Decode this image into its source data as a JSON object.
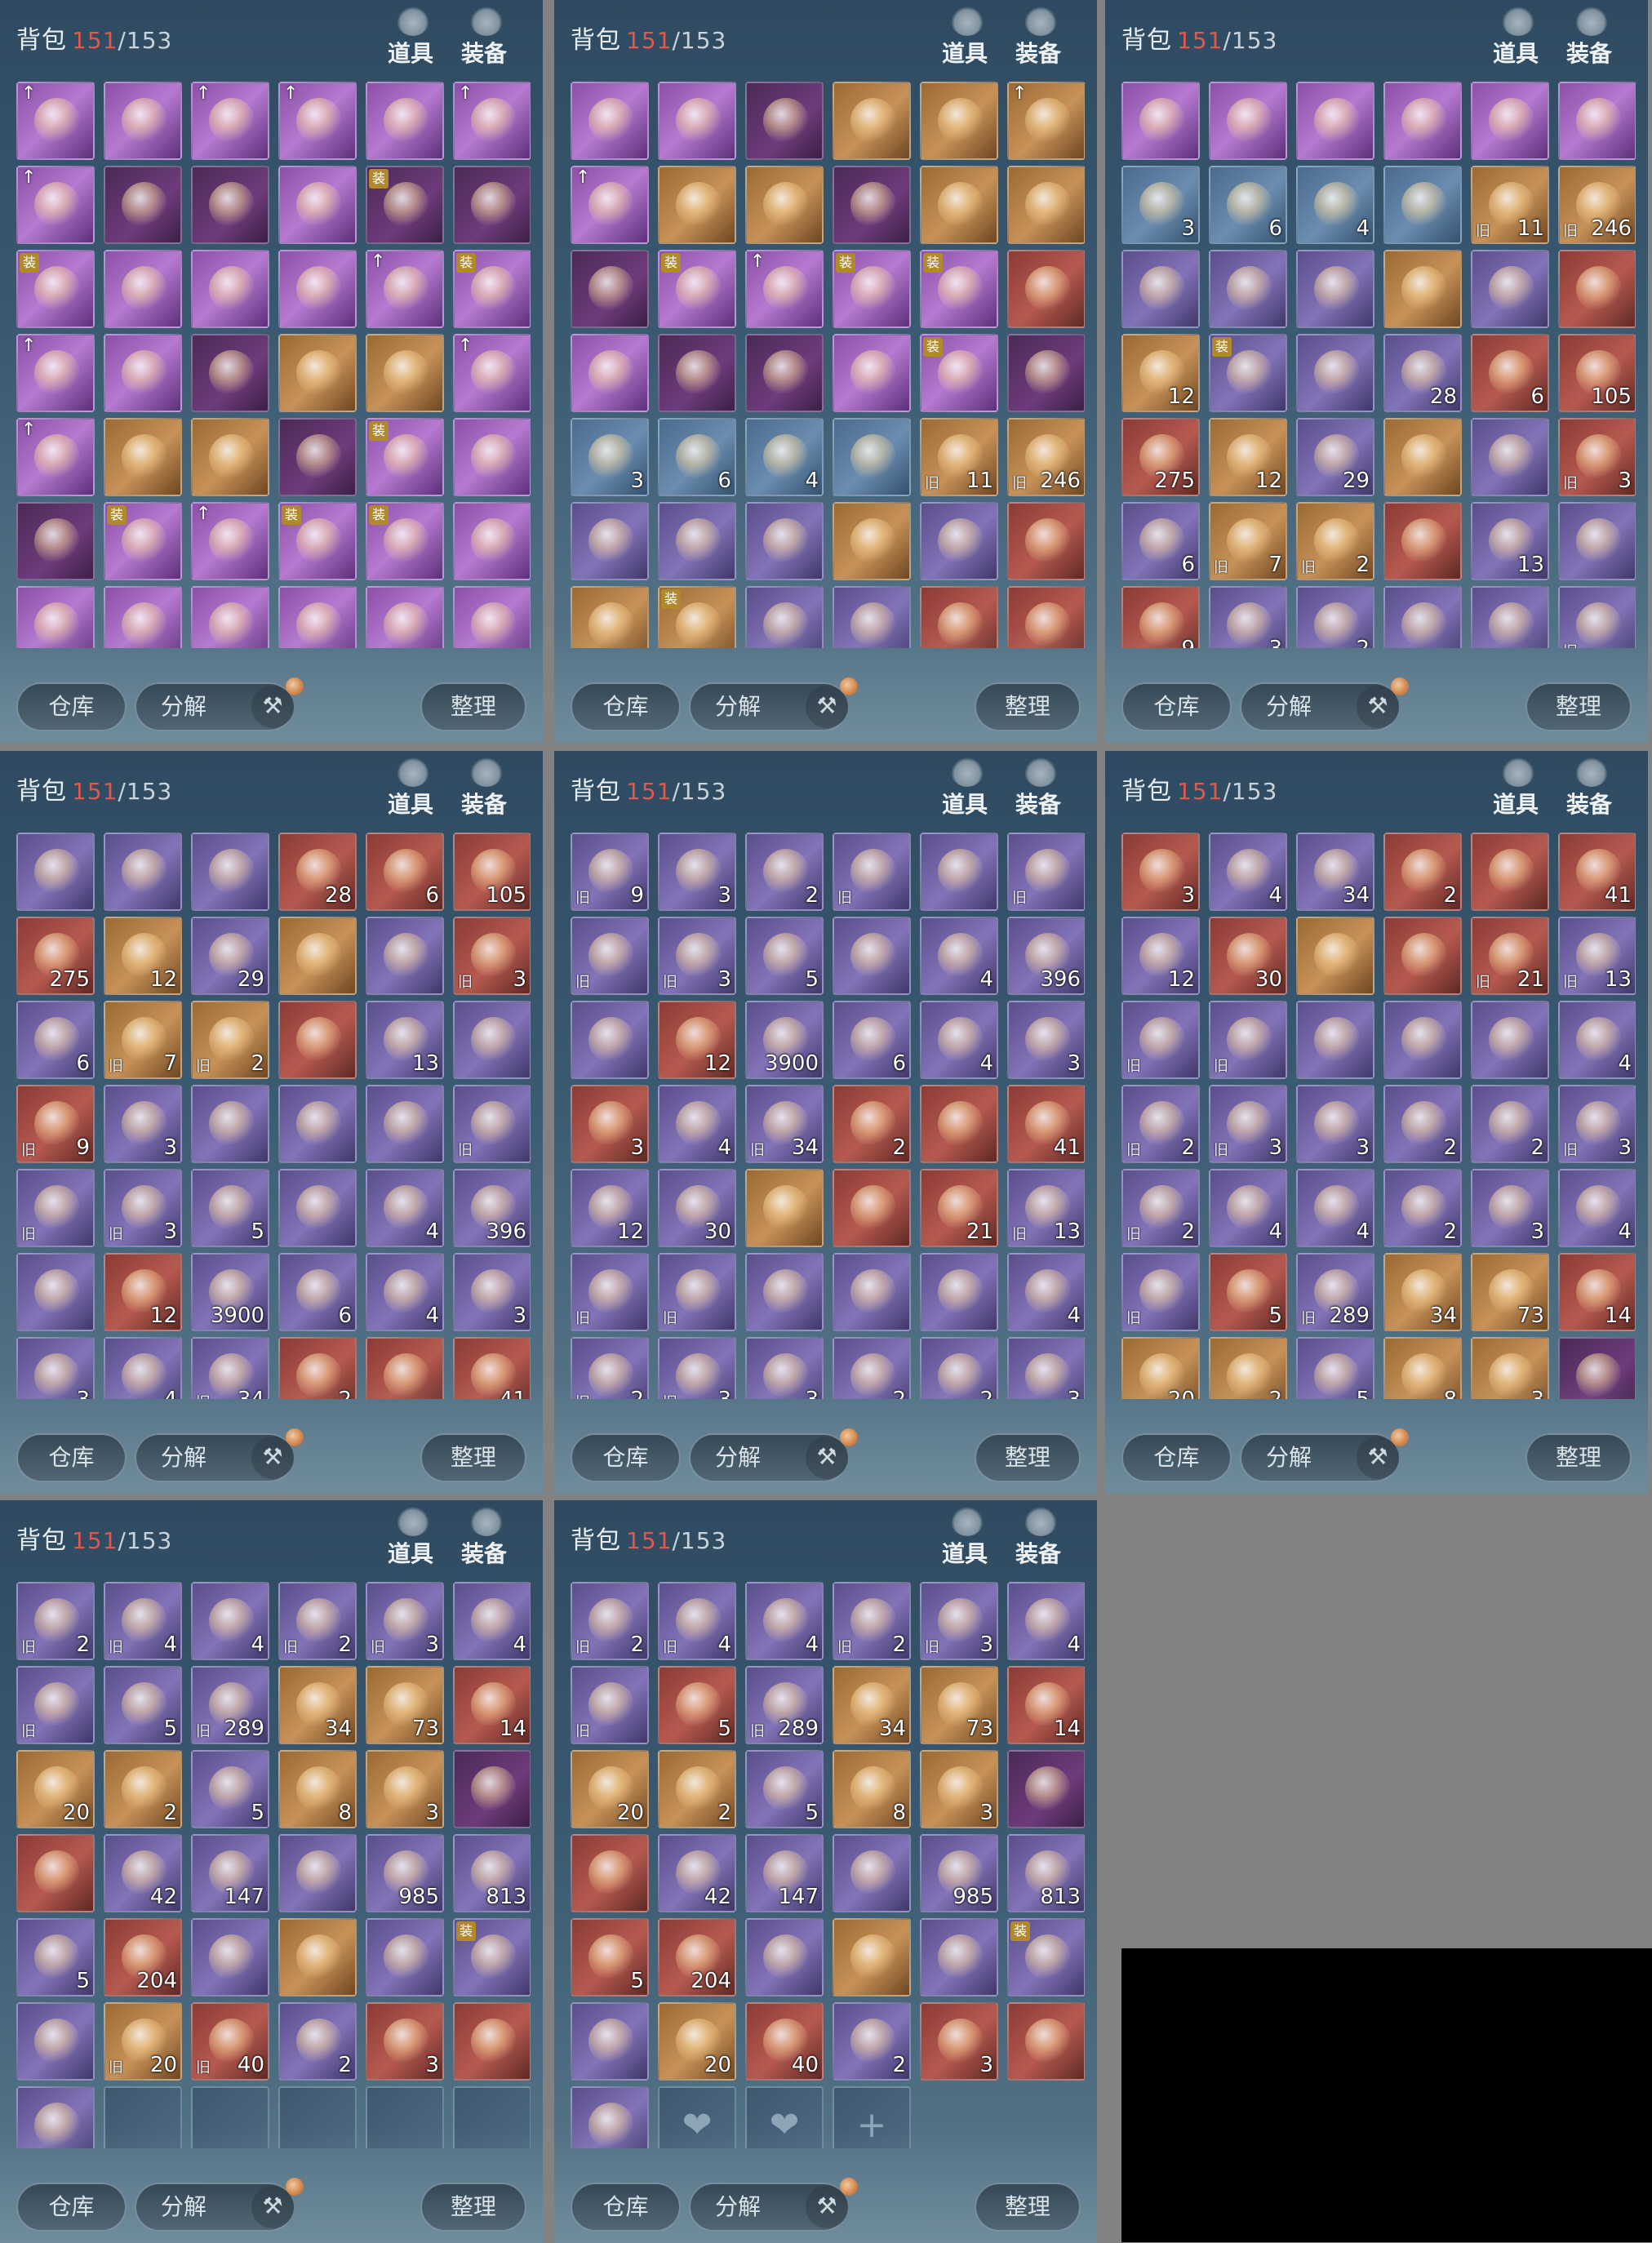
{
  "header": {
    "title": "背包",
    "count_current": "151",
    "count_sep": "/",
    "count_max": "153",
    "tab_items": "道具",
    "tab_equip": "装备"
  },
  "footer": {
    "warehouse": "仓库",
    "decompose": "分解",
    "sort": "整理"
  },
  "labels": {
    "old": "旧",
    "equip_badge": "装",
    "plus": "+"
  },
  "colors": {
    "count_current": "#e2574c",
    "background": "#828282"
  },
  "panels": [
    {
      "name": "p1",
      "rows": [
        [
          "purple::up",
          "purple::",
          "purple::up",
          "purple::up",
          "purple::",
          "purple::up"
        ],
        [
          "purple::up",
          "dpurple::",
          "dpurple::",
          "purple::",
          "dpurple::eq",
          "dpurple::"
        ],
        [
          "purple::eq",
          "purple::",
          "purple::",
          "purple::",
          "purple::up",
          "purple::eq"
        ],
        [
          "purple::up",
          "purple::",
          "dpurple::",
          "gold::",
          "gold::",
          "purple::up"
        ],
        [
          "purple::up",
          "gold::",
          "gold::",
          "dpurple::",
          "purple::eq",
          "purple::"
        ],
        [
          "dpurple::",
          "purple::eq",
          "purple::up",
          "purple::eq",
          "purple::eq",
          "purple::"
        ],
        [
          "purple::",
          "purple::",
          "purple::",
          "purple::",
          "purple::",
          "purple::"
        ]
      ]
    },
    {
      "name": "p2",
      "rows": [
        [
          "purple::",
          "purple::",
          "dpurple::",
          "gold::",
          "gold::",
          "gold::up"
        ],
        [
          "purple::up",
          "gold::",
          "gold::",
          "dpurple::",
          "gold::",
          "gold::"
        ],
        [
          "dpurple::",
          "purple::eq",
          "purple::up",
          "purple::eq",
          "purple::eq",
          "red::"
        ],
        [
          "purple::",
          "dpurple::",
          "dpurple::",
          "purple::",
          "purple::eq",
          "dpurple::"
        ],
        [
          "blue:3:",
          "blue:6:",
          "blue:4:",
          "blue::",
          "gold:11:old",
          "gold:246:old"
        ],
        [
          "violet::",
          "violet::",
          "violet::",
          "gold::",
          "violet::",
          "red::"
        ],
        [
          "gold::",
          "gold::eq",
          "violet::",
          "violet::",
          "red::",
          "red::"
        ]
      ]
    },
    {
      "name": "p3",
      "rows": [
        [
          "purple::",
          "purple::",
          "purple::",
          "purple::",
          "purple::",
          "purple::"
        ],
        [
          "blue:3:",
          "blue:6:",
          "blue:4:",
          "blue::",
          "gold:11:old",
          "gold:246:old"
        ],
        [
          "violet::",
          "violet::",
          "violet::",
          "gold::",
          "violet::",
          "red::"
        ],
        [
          "gold:12:",
          "violet::eq",
          "violet::",
          "violet:28:",
          "red:6:",
          "red:105:"
        ],
        [
          "red:275:",
          "gold:12:",
          "violet:29:",
          "gold::",
          "violet::",
          "red:3:old"
        ],
        [
          "violet:6:",
          "gold:7:old",
          "gold:2:old",
          "red::",
          "violet:13:",
          "violet::"
        ],
        [
          "red:9:",
          "violet:3:",
          "violet:2:",
          "violet::",
          "violet::",
          "violet::old"
        ]
      ]
    },
    {
      "name": "p4",
      "rows": [
        [
          "violet::",
          "violet::",
          "violet::",
          "red:28:",
          "red:6:",
          "red:105:"
        ],
        [
          "red:275:",
          "gold:12:",
          "violet:29:",
          "gold::",
          "violet::",
          "red:3:old"
        ],
        [
          "violet:6:",
          "gold:7:old",
          "gold:2:old",
          "red::",
          "violet:13:",
          "violet::"
        ],
        [
          "red:9:old",
          "violet:3:",
          "violet::",
          "violet::",
          "violet::",
          "violet::old"
        ],
        [
          "violet::old",
          "violet:3:old",
          "violet:5:",
          "violet::",
          "violet:4:",
          "violet:396:"
        ],
        [
          "violet::",
          "red:12:",
          "violet:3900:",
          "violet:6:",
          "violet:4:",
          "violet:3:"
        ],
        [
          "violet:3:",
          "violet:4:",
          "violet:34:old",
          "red:2:",
          "red::",
          "red:41:"
        ]
      ]
    },
    {
      "name": "p5",
      "rows": [
        [
          "violet:9:old",
          "violet:3:",
          "violet:2:",
          "violet::old",
          "violet::",
          "violet::old"
        ],
        [
          "violet::old",
          "violet:3:old",
          "violet:5:",
          "violet::",
          "violet:4:",
          "violet:396:"
        ],
        [
          "violet::",
          "red:12:",
          "violet:3900:",
          "violet:6:",
          "violet:4:",
          "violet:3:"
        ],
        [
          "red:3:",
          "violet:4:",
          "violet:34:old",
          "red:2:",
          "red::",
          "red:41:"
        ],
        [
          "violet:12:",
          "violet:30:",
          "gold::",
          "red::",
          "red:21:",
          "violet:13:old"
        ],
        [
          "violet::old",
          "violet::old",
          "violet::",
          "violet::",
          "violet::",
          "violet:4:"
        ],
        [
          "violet:2:old",
          "violet:3:old",
          "violet:3:",
          "violet:2:",
          "violet:2:",
          "violet:3:"
        ]
      ]
    },
    {
      "name": "p6",
      "rows": [
        [
          "red:3:",
          "violet:4:",
          "violet:34:",
          "red:2:",
          "red::",
          "red:41:"
        ],
        [
          "violet:12:",
          "red:30:",
          "gold::",
          "red::",
          "red:21:old",
          "violet:13:old"
        ],
        [
          "violet::old",
          "violet::old",
          "violet::",
          "violet::",
          "violet::",
          "violet:4:"
        ],
        [
          "violet:2:old",
          "violet:3:old",
          "violet:3:",
          "violet:2:",
          "violet:2:",
          "violet:3:old"
        ],
        [
          "violet:2:old",
          "violet:4:",
          "violet:4:",
          "violet:2:",
          "violet:3:",
          "violet:4:"
        ],
        [
          "violet::old",
          "red:5:",
          "violet:289:old",
          "gold:34:",
          "gold:73:",
          "red:14:"
        ],
        [
          "gold:20:",
          "gold:2:",
          "violet:5:",
          "gold:8:",
          "gold:3:",
          "dpurple::"
        ]
      ]
    },
    {
      "name": "p7",
      "rows": [
        [
          "violet:2:old",
          "violet:4:old",
          "violet:4:",
          "violet:2:old",
          "violet:3:old",
          "violet:4:"
        ],
        [
          "violet::old",
          "violet:5:",
          "violet:289:old",
          "gold:34:",
          "gold:73:",
          "red:14:"
        ],
        [
          "gold:20:",
          "gold:2:",
          "violet:5:",
          "gold:8:",
          "gold:3:",
          "dpurple::"
        ],
        [
          "red::",
          "violet:42:",
          "violet:147:",
          "violet::",
          "violet:985:",
          "violet:813:"
        ],
        [
          "violet:5:",
          "red:204:",
          "violet::",
          "gold::",
          "violet::",
          "violet::eq"
        ],
        [
          "violet::",
          "gold:20:old",
          "red:40:old",
          "violet:2:",
          "red:3:",
          "red::"
        ],
        [
          "violet::",
          "empty::",
          "empty::",
          "empty::",
          "empty::",
          "empty::"
        ]
      ]
    },
    {
      "name": "p8",
      "rows": [
        [
          "violet:2:old",
          "violet:4:old",
          "violet:4:",
          "violet:2:old",
          "violet:3:old",
          "violet:4:"
        ],
        [
          "violet::old",
          "red:5:",
          "violet:289:old",
          "gold:34:",
          "gold:73:",
          "red:14:"
        ],
        [
          "gold:20:",
          "gold:2:",
          "violet:5:",
          "gold:8:",
          "gold:3:",
          "dpurple::"
        ],
        [
          "red::",
          "violet:42:",
          "violet:147:",
          "violet::",
          "violet:985:",
          "violet:813:"
        ],
        [
          "red:5:",
          "red:204:",
          "violet::",
          "gold::",
          "violet::",
          "violet::eq"
        ],
        [
          "violet::",
          "gold:20:",
          "red:40:",
          "violet:2:",
          "red:3:",
          "red::"
        ],
        [
          "violet::",
          "empty:paw:",
          "empty:paw:",
          "empty:plus:",
          "none::",
          "none::"
        ]
      ]
    }
  ]
}
